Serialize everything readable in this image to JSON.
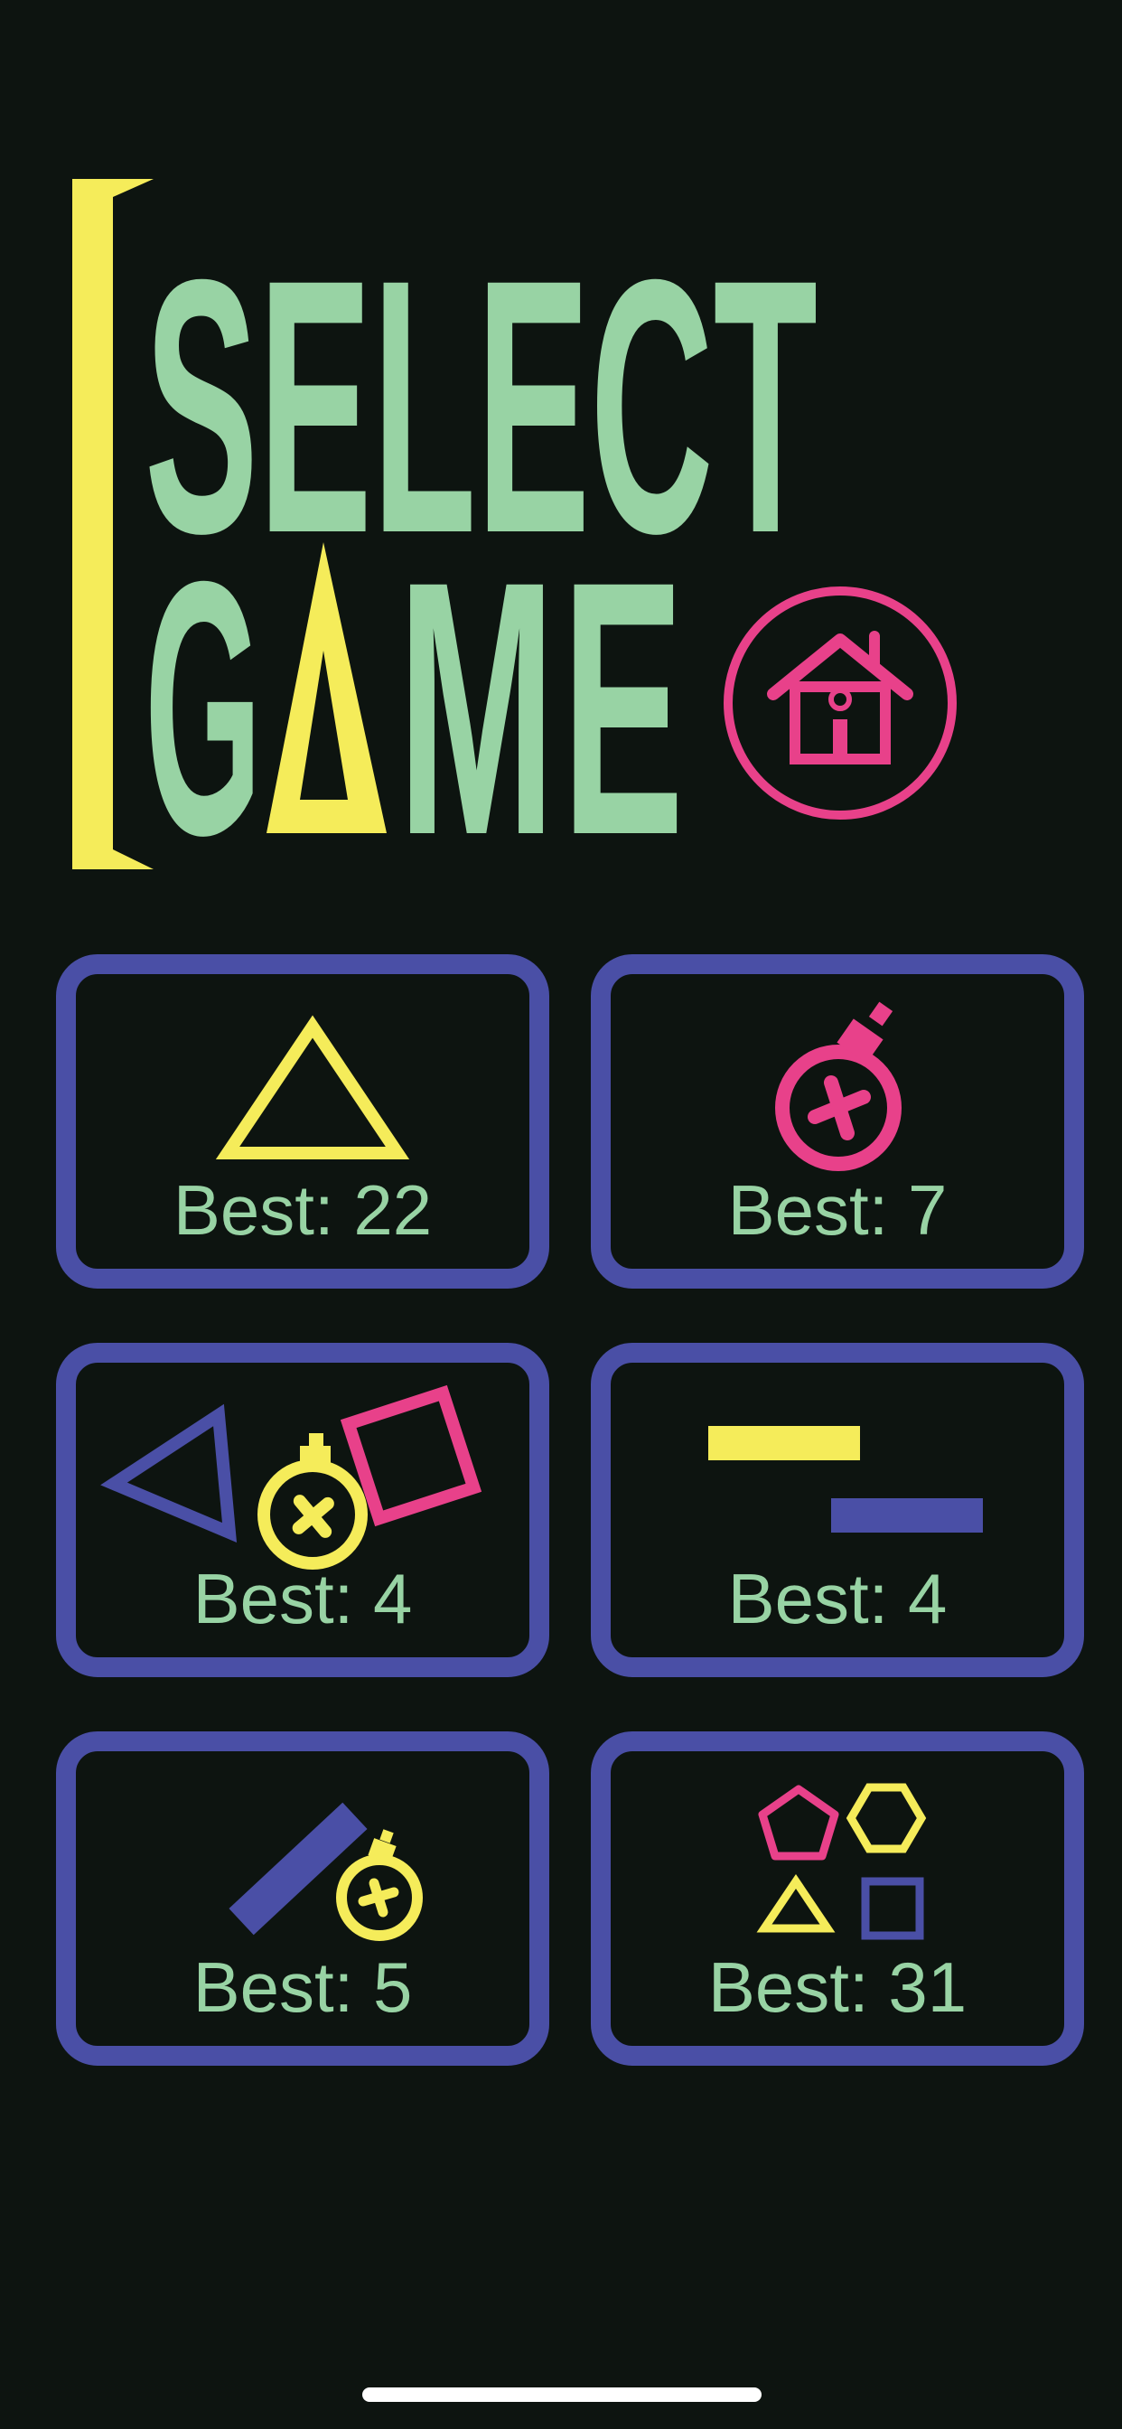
{
  "title": {
    "line1": "SELECT",
    "line2_letters": [
      "G",
      "A",
      "M",
      "E"
    ]
  },
  "colors": {
    "background": "#0d1410",
    "green": "#98d3a4",
    "yellow": "#f5ec5a",
    "pink": "#e8418a",
    "blue": "#4a4fa6"
  },
  "home": {
    "icon": "home-icon"
  },
  "games": [
    {
      "id": "triangle",
      "icon": "triangle-icon",
      "best_label": "Best: 22"
    },
    {
      "id": "bomb",
      "icon": "bomb-icon",
      "best_label": "Best: 7"
    },
    {
      "id": "shapes-bomb",
      "icon": "triangle-bomb-square-icon",
      "best_label": "Best: 4"
    },
    {
      "id": "bars",
      "icon": "bars-icon",
      "best_label": "Best: 4"
    },
    {
      "id": "stick-bomb",
      "icon": "stick-bomb-icon",
      "best_label": "Best: 5"
    },
    {
      "id": "shapes",
      "icon": "shapes-icon",
      "best_label": "Best: 31"
    }
  ]
}
